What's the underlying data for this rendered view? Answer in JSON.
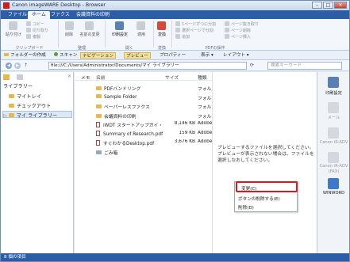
{
  "window": {
    "title": "Canon imageWARE Desktop - Browser"
  },
  "titlebar_buttons": {
    "minimize": "–",
    "maximize": "□",
    "close": "✕"
  },
  "tabs": [
    "ファイル",
    "ホーム",
    "ファクス",
    "会議資料の印刷"
  ],
  "ribbon": {
    "clipboard": {
      "paste": "貼り付け",
      "copy": "コピー",
      "cut": "切り取り",
      "duplicate": "複製",
      "label": "クリップボード"
    },
    "edit": {
      "delete": "削除",
      "rename": "名前の変更",
      "label": "整理"
    },
    "open": {
      "print_settings": "印刷設定",
      "apply": "適用",
      "label": "開く"
    },
    "convert": {
      "convert": "変換",
      "label": "変換"
    },
    "pdf": {
      "items": [
        "1ページずつに分割",
        "選択ページで分割",
        "追加",
        "ページ抜き取り",
        "ページ削除",
        "ページ挿入"
      ],
      "label": "PDFの操作"
    }
  },
  "toolbar": {
    "create_folder": "フォルダーの作成",
    "scan": "スキャン",
    "navigation": "ナビゲーション",
    "preview": "プレビュー",
    "properties": "プロパティー",
    "view": "表示",
    "layout": "レイアウト"
  },
  "address": {
    "path": "file:///C:/Users/Administrator/Documents/マイ ライブラリー"
  },
  "search": {
    "placeholder": "検索キーワード"
  },
  "library": {
    "label": "ライブラリー",
    "items": [
      "マイトレイ",
      "チェックアウト",
      "マイ ライブラリー"
    ]
  },
  "file_list": {
    "headers": {
      "memo": "メモ",
      "name": "名前",
      "size": "サイズ",
      "type": "種類"
    },
    "rows": [
      {
        "name": "PDFバンドリング",
        "size": "",
        "type": "フォル",
        "kind": "folder"
      },
      {
        "name": "Sample Folder",
        "size": "",
        "type": "フォル",
        "kind": "folder"
      },
      {
        "name": "ペーパーレスファクス",
        "size": "",
        "type": "フォル",
        "kind": "folder"
      },
      {
        "name": "会議資料の印刷",
        "size": "",
        "type": "フォル",
        "kind": "folder"
      },
      {
        "name": "iWDT スタートアップガイ・",
        "size": "8,146 KB",
        "type": "Adobe",
        "kind": "pdf"
      },
      {
        "name": "Summary of Research.pdf",
        "size": "159 KB",
        "type": "Adobe",
        "kind": "pdf"
      },
      {
        "name": "すぐわかるDesktop.pdf",
        "size": "3,676 KB",
        "type": "Adobe",
        "kind": "pdf"
      },
      {
        "name": "ごみ箱",
        "size": "",
        "type": "",
        "kind": "trash"
      }
    ]
  },
  "preview": {
    "message": "プレビューするファイルを選択してください。プレビューが表示されない場合は、ファイルを選択しなおしてください。"
  },
  "context_menu": {
    "items": [
      "変更(C)",
      "ボタンの削除する(E)",
      "削除(D)"
    ]
  },
  "output_bar": {
    "items": [
      "印刷設定",
      "メール",
      "Canon iR-ADV",
      "Canon iR-ADV (FAX)",
      "WINWORD"
    ]
  },
  "status": {
    "text": "8 個の項目"
  },
  "colors": {
    "accent": "#2c5ea8",
    "highlight": "#e0161b"
  }
}
